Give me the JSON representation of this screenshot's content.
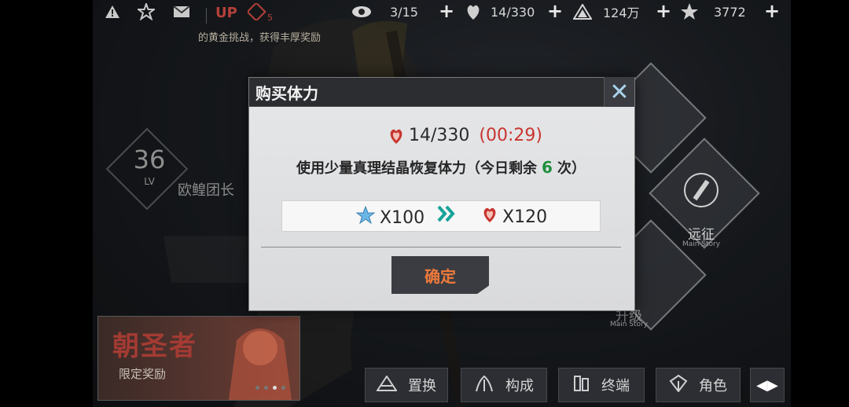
{
  "topbar": {
    "up_label": "UP",
    "up_badge": "5",
    "resources": [
      {
        "icon": "eye-icon",
        "value": "3/15"
      },
      {
        "icon": "stamina-heart-icon",
        "value": "14/330"
      },
      {
        "icon": "triangle-coin-icon",
        "value": "124万"
      },
      {
        "icon": "crystal-star-icon",
        "value": "3772"
      }
    ],
    "plus_label": "+",
    "subtitle": "的黄金挑战，获得丰厚奖励"
  },
  "profile": {
    "level": "36",
    "level_label": "LV",
    "name": "欧鳇团长"
  },
  "banner": {
    "title": "朝圣者",
    "subtitle": "限定奖励"
  },
  "menu": {
    "expedition_label": "远征",
    "expedition_en": "Main Story",
    "other_label": "升级",
    "other_en": "Main Story"
  },
  "bottom": {
    "buttons": [
      {
        "label": "置换",
        "icon": "swap-triangle-icon"
      },
      {
        "label": "构成",
        "icon": "formation-icon"
      },
      {
        "label": "终端",
        "icon": "terminal-icon"
      },
      {
        "label": "角色",
        "icon": "character-icon"
      }
    ],
    "arrow_label": "◀▶"
  },
  "dialog": {
    "title": "购买体力",
    "close_label": "✕",
    "stamina_value": "14/330",
    "stamina_timer": "(00:29)",
    "desc_prefix": "使用少量真理结晶恢复体力（今日剩余",
    "desc_count": "6",
    "desc_suffix": "次）",
    "cost_amount": "X100",
    "gain_amount": "X120",
    "confirm_label": "确定"
  },
  "colors": {
    "timer_red": "#c8352f",
    "count_green": "#1f8f3d",
    "confirm_orange": "#f07a3b",
    "arrow_teal": "#17a39a"
  }
}
